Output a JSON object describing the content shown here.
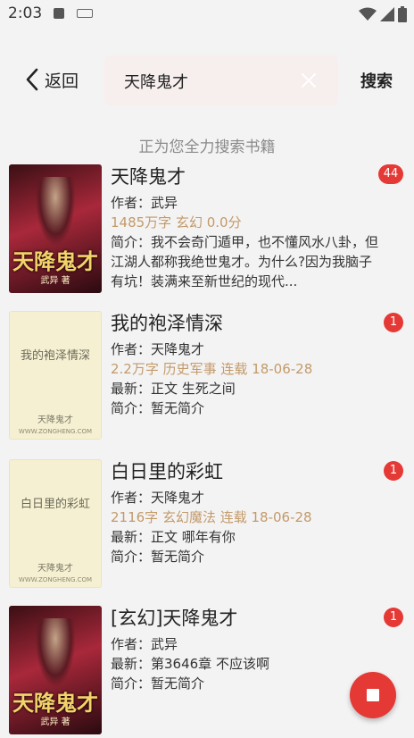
{
  "status_bar": {
    "time": "2:03"
  },
  "toolbar": {
    "back_label": "返回",
    "search_value": "天降鬼才",
    "search_button_label": "搜索"
  },
  "hint": "正为您全力搜索书籍",
  "results": [
    {
      "title": "天降鬼才",
      "author": "作者：武异",
      "meta": "1485万字  玄幻  0.0分",
      "intro": "简介：我不会奇门遁甲，也不懂风水八卦，但江湖人都称我绝世鬼才。为什么?因为我脑子有坑！装满来至新世纪的现代...",
      "badge": "44",
      "cover": {
        "title": "天降鬼才",
        "author": "武异 著"
      }
    },
    {
      "title": "我的袍泽情深",
      "author": "作者：天降鬼才",
      "meta": "2.2万字  历史军事  连载  18-06-28",
      "latest": "最新：正文 生死之间",
      "intro": "简介：暂无简介",
      "badge": "1",
      "cover": {
        "title": "我的袍泽情深",
        "author": "天降鬼才",
        "site": "WWW.ZONGHENG.COM"
      }
    },
    {
      "title": "白日里的彩虹",
      "author": "作者：天降鬼才",
      "meta": "2116字  玄幻魔法  连载  18-06-28",
      "latest": "最新：正文 哪年有你",
      "intro": "简介：暂无简介",
      "badge": "1",
      "cover": {
        "title": "白日里的彩虹",
        "author": "天降鬼才",
        "site": "WWW.ZONGHENG.COM"
      }
    },
    {
      "title": "[玄幻]天降鬼才",
      "author": "作者：武异",
      "latest": "最新：第3646章 不应该啊",
      "intro": "简介：暂无简介",
      "badge": "1",
      "cover": {
        "title": "天降鬼才",
        "author": "武异 著"
      }
    }
  ],
  "colors": {
    "accent": "#e53935",
    "meta": "#c29a69",
    "background": "#f4f3f4"
  }
}
